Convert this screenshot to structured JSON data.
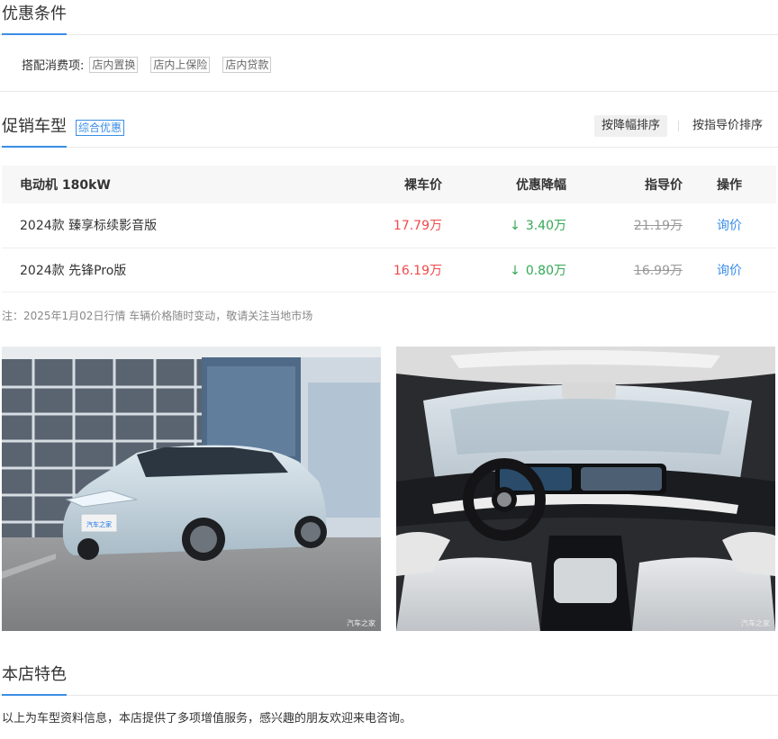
{
  "offers": {
    "title": "优惠条件",
    "package_label": "搭配消费项:",
    "tags": [
      "店内置换",
      "店内上保险",
      "店内贷款"
    ]
  },
  "promo": {
    "title": "促销车型",
    "tag": "综合优惠",
    "sort_desc_discount": "按降幅排序",
    "sort_guide_price": "按指导价排序"
  },
  "table": {
    "headers": {
      "name": "电动机 180kW",
      "price": "裸车价",
      "discount": "优惠降幅",
      "guide": "指导价",
      "op": "操作"
    },
    "rows": [
      {
        "name": "2024款 臻享标续影音版",
        "price": "17.79万",
        "discount": "3.40万",
        "guide": "21.19万",
        "op": "询价"
      },
      {
        "name": "2024款 先锋Pro版",
        "price": "16.19万",
        "discount": "0.80万",
        "guide": "16.99万",
        "op": "询价"
      }
    ],
    "arrow_icon": "arrow-down-icon"
  },
  "note": "注：2025年1月02日行情 车辆价格随时变动，敬请关注当地市场",
  "photos": {
    "watermark": "汽车之家",
    "plate": "汽车之家"
  },
  "features": {
    "title": "本店特色",
    "text": "以上为车型资料信息，本店提供了多项增值服务，感兴趣的朋友欢迎来电咨询。"
  },
  "colors": {
    "accent": "#3a8ee6",
    "price_red": "#f04a4a",
    "discount_green": "#33a854"
  }
}
